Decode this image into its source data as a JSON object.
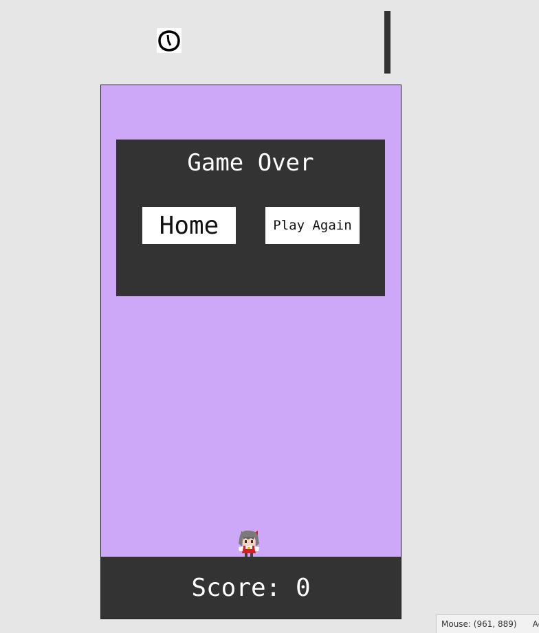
{
  "hud": {
    "timer_icon": "clock-icon"
  },
  "game_over": {
    "title": "Game Over",
    "home_label": "Home",
    "play_again_label": "Play Again"
  },
  "score": {
    "label": "Score:",
    "value": "0"
  },
  "player": {
    "sprite": "shrine-maiden-sprite"
  },
  "status": {
    "mouse": "Mouse: (961, 889)",
    "extra": "Act"
  },
  "colors": {
    "background": "#e6e6e6",
    "game_area": "#cda8f8",
    "panel": "#333333",
    "button": "#ffffff",
    "text_light": "#ffffff"
  }
}
